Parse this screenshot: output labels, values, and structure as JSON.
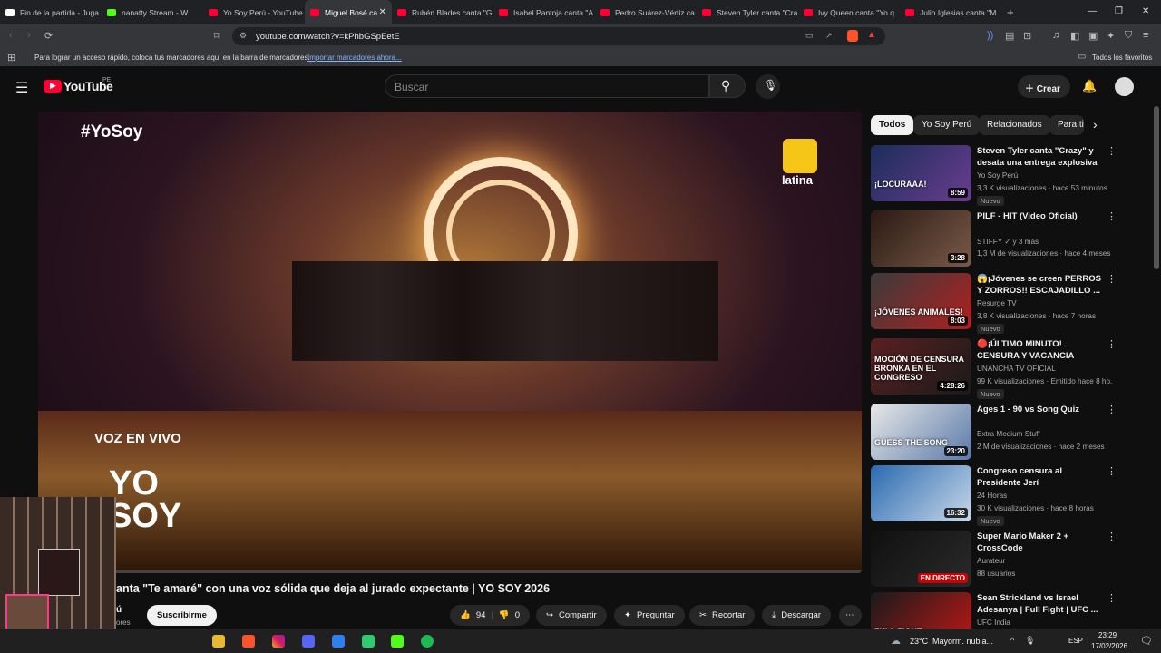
{
  "browser": {
    "tabs": [
      {
        "label": "Fin de la partida - Juga",
        "color": "#ffffff"
      },
      {
        "label": "nanatty Stream - W",
        "color": "#53fc18"
      },
      {
        "label": "Yo Soy Perú - YouTube",
        "color": "#ff0033"
      },
      {
        "label": "Miguel Bosé ca",
        "color": "#ff0033"
      },
      {
        "label": "Rubén Blades canta \"G",
        "color": "#ff0033"
      },
      {
        "label": "Isabel Pantoja canta \"A",
        "color": "#ff0033"
      },
      {
        "label": "Pedro Suárez-Vértiz ca",
        "color": "#ff0033"
      },
      {
        "label": "Steven Tyler canta \"Cra",
        "color": "#ff0033"
      },
      {
        "label": "Ivy Queen canta \"Yo q",
        "color": "#ff0033"
      },
      {
        "label": "Julio Iglesias canta \"M",
        "color": "#ff0033"
      }
    ],
    "new_tab": "+",
    "url": "youtube.com/watch?v=kPhbGSpEetE",
    "bookmarks_hint": "Para lograr un acceso rápido, coloca tus marcadores aquí en la barra de marcadores.",
    "bookmarks_import": "Importar marcadores ahora...",
    "all_favorites": "Todos los favoritos"
  },
  "youtube": {
    "logo": "YouTube",
    "region": "PE",
    "search_placeholder": "Buscar",
    "create_label": "Crear"
  },
  "video": {
    "overlay_tag": "#YoSoy",
    "overlay_live": "VOZ EN VIVO",
    "overlay_logo": "YO SOY",
    "channel_logo": "latina",
    "title": "anta \"Te amaré\" con una voz sólida que deja al jurado expectante | YO SOY 2026",
    "channel_partial": "ú",
    "subs_partial": "ores",
    "subscribe_label": "Suscribirme",
    "likes": "94",
    "dislikes": "0",
    "share_label": "Compartir",
    "ask_label": "Preguntar",
    "clip_label": "Recortar",
    "download_label": "Descargar",
    "more": "⋯"
  },
  "chips": [
    "Todos",
    "Yo Soy Perú",
    "Relacionados",
    "Para ti"
  ],
  "recommendations": [
    {
      "title": "Steven Tyler canta \"Crazy\" y desata una entrega explosiva ...",
      "channel": "Yo Soy Perú",
      "meta": "3,3 K visualizaciones · hace 53 minutos",
      "badge": "Nuevo",
      "duration": "8:59",
      "thumb_text": "¡LOCURAAA!",
      "c1": "#1b2d5a",
      "c2": "#6a3d8f"
    },
    {
      "title": "PILF - HIT (Video Oficial)",
      "channel": "STIFFY",
      "channel_suffix": "y 3 más",
      "meta": "1,3 M de visualizaciones · hace 4 meses",
      "badge": "",
      "duration": "3:28",
      "thumb_text": "",
      "c1": "#2a1a14",
      "c2": "#7a5a48"
    },
    {
      "title": "😱¡Jóvenes se creen PERROS Y ZORROS!! ESCAJADILLO ...",
      "channel": "Resurge TV",
      "meta": "3,8 K visualizaciones · hace 7 horas",
      "badge": "Nuevo",
      "duration": "8:03",
      "thumb_text": "¡JÓVENES ANIMALES!",
      "c1": "#3b3b3b",
      "c2": "#b02020"
    },
    {
      "title": "🔴¡ÚLTIMO MINUTO! CENSURA Y VACANCIA CONTRA JOSÉ ...",
      "channel": "UNANCHA TV OFICIAL",
      "meta": "99 K visualizaciones · Emitido hace 8 ho...",
      "badge": "Nuevo",
      "duration": "4:28:26",
      "thumb_text": "MOCIÓN DE CENSURA BRONKA EN EL CONGRESO",
      "c1": "#5a2020",
      "c2": "#1a1a1a"
    },
    {
      "title": "Ages 1 - 90 vs Song Quiz",
      "channel": "Extra Medium Stuff",
      "meta": "2 M de visualizaciones · hace 2 meses",
      "badge": "",
      "duration": "23:20",
      "thumb_text": "GUESS THE SONG",
      "c1": "#e8e8e8",
      "c2": "#5a7aa8"
    },
    {
      "title": "Congreso censura al Presidente Jerí",
      "channel": "24 Horas",
      "meta": "30 K visualizaciones · hace 8 horas",
      "badge": "Nuevo",
      "duration": "16:32",
      "thumb_text": "",
      "c1": "#2a6ab0",
      "c2": "#c8d8e8"
    },
    {
      "title": "Super Mario Maker 2 + CrossCode",
      "channel": "Aurateur",
      "meta": "88 usuarios",
      "badge": "",
      "duration": "EN DIRECTO",
      "thumb_text": "",
      "c1": "#101010",
      "c2": "#2a2a2a"
    },
    {
      "title": "Sean Strickland vs Israel Adesanya | Full Fight | UFC ...",
      "channel": "UFC India",
      "meta": "",
      "badge": "",
      "duration": "",
      "thumb_text": "FULL FIGHT",
      "c1": "#1a1a1a",
      "c2": "#c01818"
    }
  ],
  "taskbar": {
    "temp": "23°C",
    "weather": "Mayorm. nubla...",
    "lang": "ESP",
    "time": "23:29",
    "date": "17/02/2026"
  }
}
